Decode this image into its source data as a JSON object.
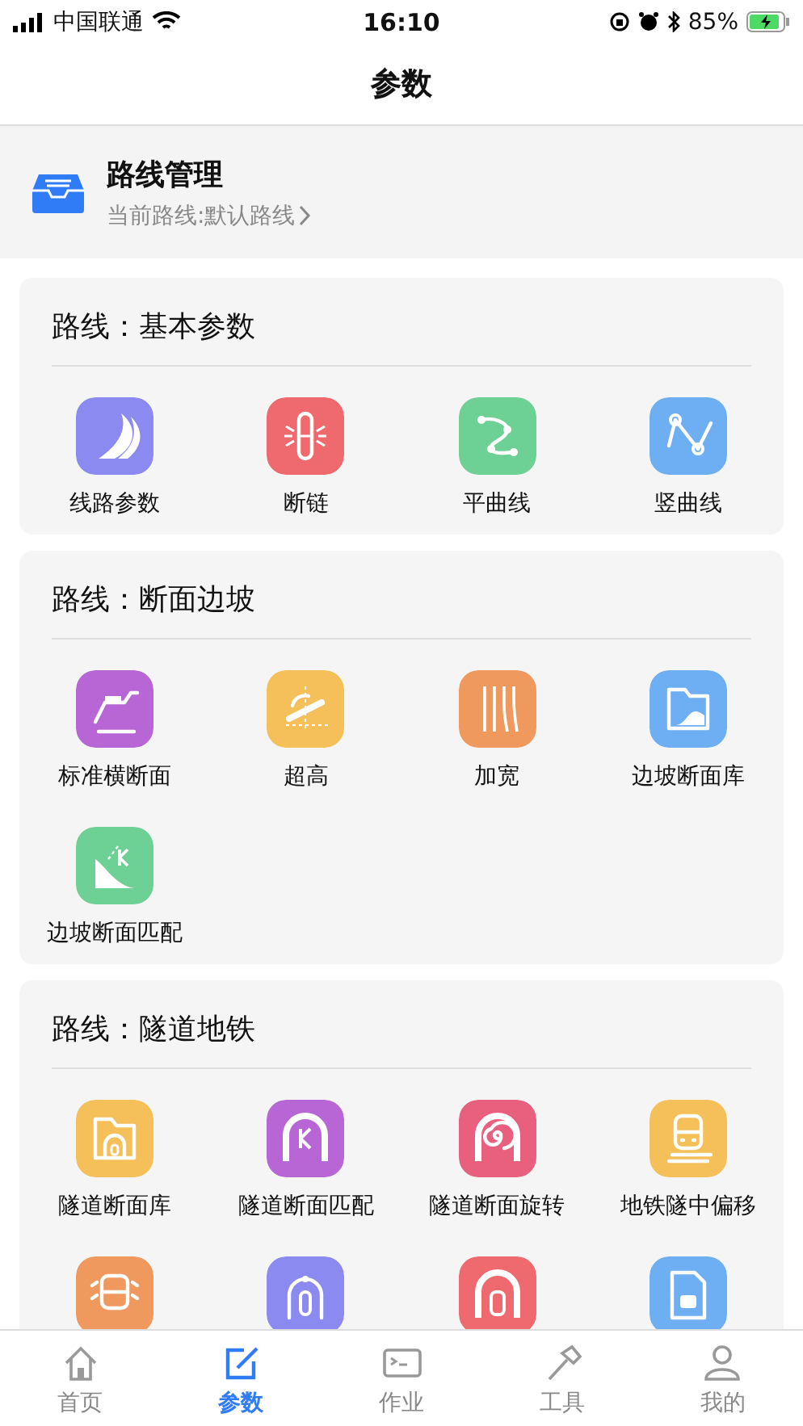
{
  "status_bar": {
    "carrier": "中国联通",
    "time": "16:10",
    "battery": "85%"
  },
  "nav_bar": {
    "title": "参数"
  },
  "route_card": {
    "title": "路线管理",
    "subtitle": "当前路线:默认路线"
  },
  "sections": [
    {
      "title": "路线：基本参数",
      "items": [
        {
          "label": "线路参数",
          "color": "#8a8af0"
        },
        {
          "label": "断链",
          "color": "#ee6a6e"
        },
        {
          "label": "平曲线",
          "color": "#6dd196"
        },
        {
          "label": "竖曲线",
          "color": "#6eaef2"
        }
      ]
    },
    {
      "title": "路线：断面边坡",
      "items": [
        {
          "label": "标准横断面",
          "color": "#b866d6"
        },
        {
          "label": "超高",
          "color": "#f5bf5a"
        },
        {
          "label": "加宽",
          "color": "#f0995e"
        },
        {
          "label": "边坡断面库",
          "color": "#6eaef2"
        },
        {
          "label": "边坡断面匹配",
          "color": "#6dd196"
        }
      ]
    },
    {
      "title": "路线：隧道地铁",
      "items": [
        {
          "label": "隧道断面库",
          "color": "#f5bf5a"
        },
        {
          "label": "隧道断面匹配",
          "color": "#b866d6"
        },
        {
          "label": "隧道断面旋转",
          "color": "#e9607e"
        },
        {
          "label": "地铁隧中偏移",
          "color": "#f5bf5a"
        },
        {
          "color": "#f0995e"
        },
        {
          "color": "#8a8af0"
        },
        {
          "color": "#ee6a6e"
        },
        {
          "color": "#6eaef2"
        }
      ]
    }
  ],
  "tab_bar": [
    {
      "label": "首页",
      "selected": false
    },
    {
      "label": "参数",
      "selected": true
    },
    {
      "label": "作业",
      "selected": false
    },
    {
      "label": "工具",
      "selected": false
    },
    {
      "label": "我的",
      "selected": false
    }
  ]
}
